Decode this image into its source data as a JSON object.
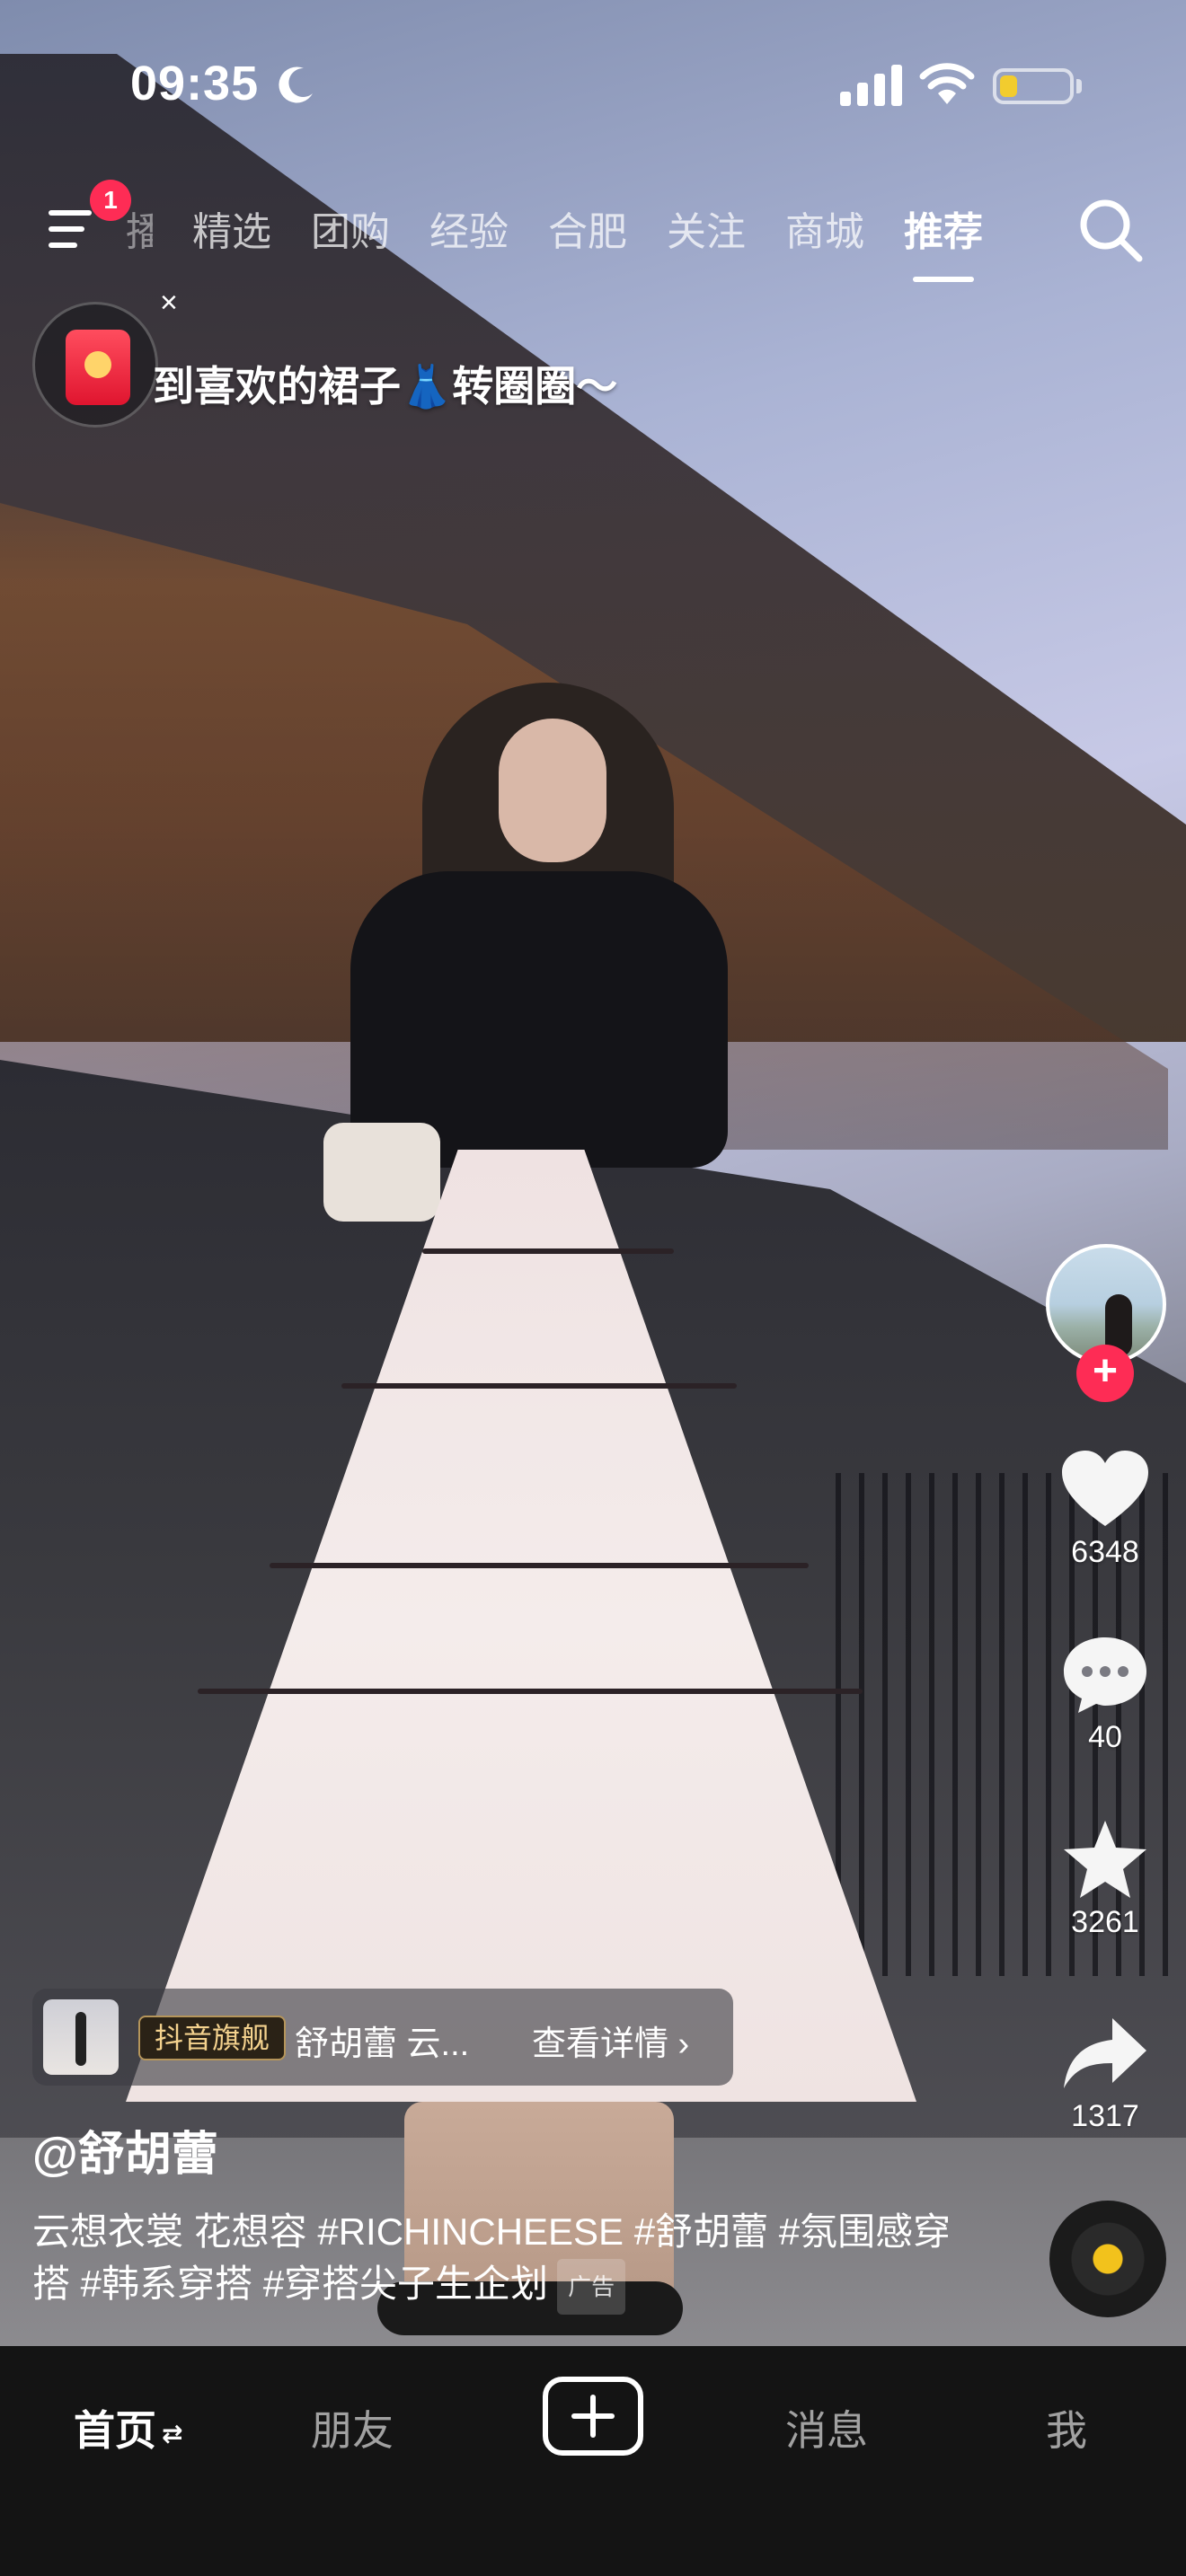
{
  "status_bar": {
    "time": "09:35",
    "battery_level": 0.25,
    "battery_color": "#f2cc2e"
  },
  "top_nav": {
    "notification_count": "1",
    "tabs": [
      {
        "label": "播",
        "active": false
      },
      {
        "label": "精选",
        "active": false
      },
      {
        "label": "团购",
        "active": false
      },
      {
        "label": "经验",
        "active": false
      },
      {
        "label": "合肥",
        "active": false
      },
      {
        "label": "关注",
        "active": false
      },
      {
        "label": "商城",
        "active": false
      },
      {
        "label": "推荐",
        "active": true
      }
    ]
  },
  "overlay": {
    "close_label": "×",
    "text": "到喜欢的裙子👗转圈圈～"
  },
  "right_actions": {
    "follow_label": "+",
    "like_count": "6348",
    "comment_count": "40",
    "favorite_count": "3261",
    "share_count": "1317"
  },
  "product_card": {
    "brand_tag": "抖音旗舰",
    "name": "舒胡蕾 云...",
    "detail_label": "查看详情 ›"
  },
  "video_info": {
    "author": "@舒胡蕾",
    "caption": "云想衣裳 花想容 #RICHINCHEESE #舒胡蕾 #氛围感穿搭 #韩系穿搭 #穿搭尖子生企划",
    "ad_label": "广告"
  },
  "bottom_nav": {
    "home": "首页",
    "home_swap": "⇄",
    "friends": "朋友",
    "messages": "消息",
    "me": "我"
  },
  "colors": {
    "accent": "#fe2c55",
    "nav_bg": "#141414"
  }
}
